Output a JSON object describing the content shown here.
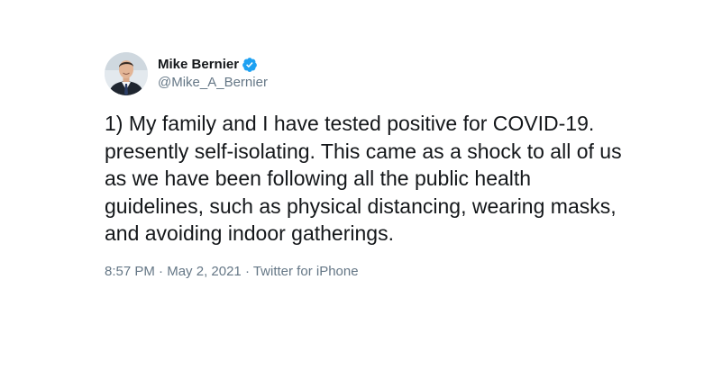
{
  "tweet": {
    "display_name": "Mike Bernier",
    "handle": "@Mike_A_Bernier",
    "verified": true,
    "verified_color": "#1da1f2",
    "text": "1) My family and I have tested positive for COVID-19.\npresently self-isolating. This came as a shock to all of us\nas we have been following all the public health\nguidelines, such as physical distancing, wearing masks,\nand avoiding indoor gatherings.",
    "time": "8:57 PM",
    "date": "May 2, 2021",
    "source": "Twitter for iPhone",
    "separator": " · "
  },
  "icons": {
    "avatar": "avatar-photo",
    "verified": "verified-badge-icon"
  }
}
